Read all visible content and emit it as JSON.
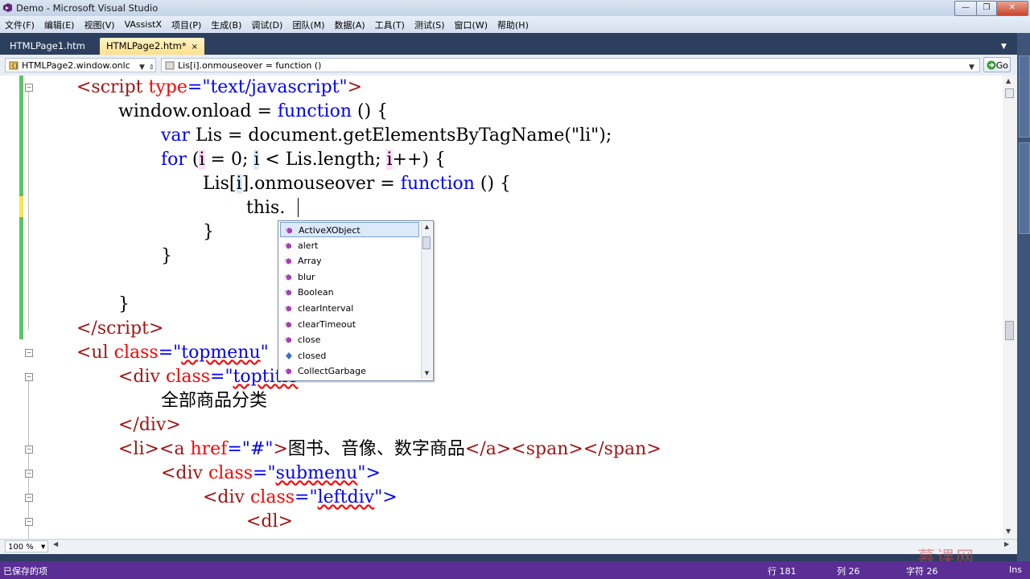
{
  "window": {
    "title": "Demo - Microsoft Visual Studio",
    "minimize_label": "—",
    "maximize_label": "❐",
    "close_label": "✕"
  },
  "menu": [
    "文件(F)",
    "编辑(E)",
    "视图(V)",
    "VAssistX",
    "项目(P)",
    "生成(B)",
    "调试(D)",
    "团队(M)",
    "数据(A)",
    "工具(T)",
    "测试(S)",
    "窗口(W)",
    "帮助(H)"
  ],
  "tabs": [
    {
      "label": "HTMLPage1.htm",
      "active": false
    },
    {
      "label": "HTMLPage2.htm*",
      "active": true,
      "close": "×"
    }
  ],
  "nav": {
    "scope": "HTMLPage2.window.onlc",
    "member": "Lis[i].onmouseover = function ()",
    "go_label": "Go"
  },
  "code_lines": [
    [
      "<script",
      " type",
      "=\"text/javascript\"",
      ">"
    ],
    [
      "window.onload = ",
      "function",
      " () {"
    ],
    [
      "var",
      " Lis = document.getElementsByTagName(\"li\");"
    ],
    [
      "for",
      " (",
      "i",
      " = 0; ",
      "i",
      " < Lis.length; ",
      "i",
      "++) {"
    ],
    [
      "Lis[",
      "i",
      "].onmouseover = ",
      "function",
      " () {"
    ],
    [
      "this."
    ],
    [
      "}"
    ],
    [
      "}"
    ],
    [
      "}"
    ],
    [
      "</script",
      ">"
    ],
    [
      "<ul",
      " class",
      "=\"",
      "topmenu",
      "\""
    ],
    [
      "<div",
      " class",
      "=\"",
      "toptitle",
      "\">"
    ],
    [
      "全部商品分类"
    ],
    [
      "</div",
      ">"
    ],
    [
      "<li",
      "><a",
      " href",
      "=\"#\"",
      ">",
      "图书、音像、数字商品",
      "</a",
      "><span",
      "></span",
      ">"
    ],
    [
      "<div",
      " class",
      "=\"",
      "submenu",
      "\">"
    ],
    [
      "<div",
      " class",
      "=\"",
      "leftdiv",
      "\">"
    ],
    [
      "<dl",
      ">"
    ]
  ],
  "intellisense": {
    "items": [
      "ActiveXObject",
      "alert",
      "Array",
      "blur",
      "Boolean",
      "clearInterval",
      "clearTimeout",
      "close",
      "closed",
      "CollectGarbage"
    ],
    "selected_index": 0
  },
  "zoom": "100 %",
  "status": {
    "message": "已保存的项",
    "line": "行 181",
    "col": "列 26",
    "char": "字符 26",
    "mode": "Ins"
  },
  "watermark": "慕课网",
  "colors": {
    "keyword": "#0000ff",
    "tag": "#a31515",
    "attribute": "#ff0000",
    "status_bar": "#5a2e95"
  }
}
